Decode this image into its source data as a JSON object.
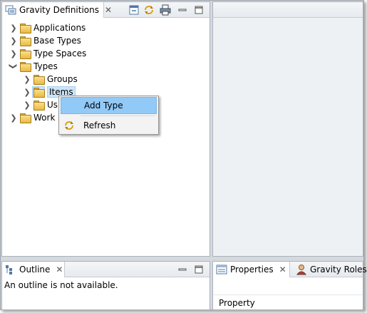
{
  "definitions_view": {
    "tab_label": "Gravity Definitions",
    "tab_icon": "gravity-definitions-icon",
    "close_glyph": "✕",
    "toolbar": [
      "collapse-all-icon",
      "refresh-icon",
      "print-icon",
      "minimize-icon",
      "maximize-icon"
    ],
    "tree": [
      {
        "label": "Applications",
        "expanded": false
      },
      {
        "label": "Base Types",
        "expanded": false
      },
      {
        "label": "Type Spaces",
        "expanded": false
      },
      {
        "label": "Types",
        "expanded": true,
        "children": [
          {
            "label": "Groups"
          },
          {
            "label": "Items",
            "selected": true
          },
          {
            "label": "Us"
          }
        ]
      },
      {
        "label": "Work",
        "expanded": false
      }
    ]
  },
  "context_menu": {
    "items": [
      {
        "label": "Add Type",
        "highlighted": true,
        "icon": ""
      },
      {
        "label": "Refresh",
        "highlighted": false,
        "icon": "refresh-icon"
      }
    ]
  },
  "outline_view": {
    "tab_label": "Outline",
    "tab_icon": "outline-icon",
    "message": "An outline is not available."
  },
  "properties_view": {
    "tab_label": "Properties",
    "tab_icon": "properties-icon",
    "second_tab_label": "Gravity Roles",
    "second_tab_icon": "gravity-roles-icon",
    "column_header": "Property"
  },
  "colors": {
    "menu_highlight": "#91c9f7",
    "folder": "#e9b943",
    "frame": "#d6d9dd"
  }
}
